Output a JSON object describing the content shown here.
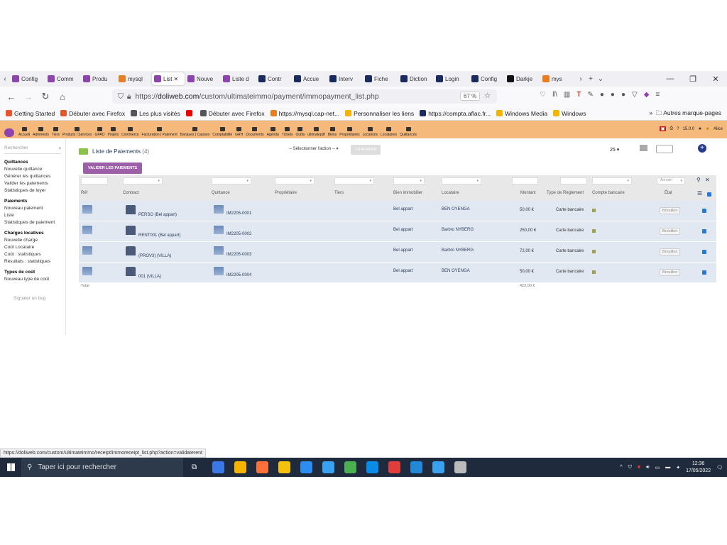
{
  "browser": {
    "tabs": [
      {
        "label": "Config",
        "color": "#8e44ad"
      },
      {
        "label": "Comm",
        "color": "#8e44ad"
      },
      {
        "label": "Produ",
        "color": "#8e44ad"
      },
      {
        "label": "mysql",
        "color": "#e67e22"
      },
      {
        "label": "List",
        "color": "#8e44ad",
        "active": true
      },
      {
        "label": "Nouve",
        "color": "#8e44ad"
      },
      {
        "label": "Liste d",
        "color": "#8e44ad"
      },
      {
        "label": "Contr",
        "color": "#1a2a5c"
      },
      {
        "label": "Accue",
        "color": "#1a2a5c"
      },
      {
        "label": "Interv",
        "color": "#1a2a5c"
      },
      {
        "label": "Fiche",
        "color": "#1a2a5c"
      },
      {
        "label": "Diction",
        "color": "#1a2a5c"
      },
      {
        "label": "Login",
        "color": "#1a2a5c"
      },
      {
        "label": "Config",
        "color": "#1a2a5c"
      },
      {
        "label": "Darkje",
        "color": "#111"
      },
      {
        "label": "mys",
        "color": "#e67e22"
      }
    ],
    "url_prefix": "https://",
    "url_domain": "doliweb.com",
    "url_path": "/custom/ultimateimmo/payment/immopayment_list.php",
    "zoom": "67 %",
    "bookmarks": [
      {
        "label": "Getting Started",
        "color": "#e8542c"
      },
      {
        "label": "Débuter avec Firefox",
        "color": "#e8542c"
      },
      {
        "label": "Les plus visités",
        "color": "#555"
      },
      {
        "label": "",
        "color": "#e00"
      },
      {
        "label": "Débuter avec Firefox",
        "color": "#555"
      },
      {
        "label": "https://mysql.cap-net...",
        "color": "#e67e22"
      },
      {
        "label": "Personnaliser les liens",
        "color": "#f4b400"
      },
      {
        "label": "https://compta.aflac.fr...",
        "color": "#1a2a5c"
      },
      {
        "label": "Windows Media",
        "color": "#f4b400"
      },
      {
        "label": "Windows",
        "color": "#f4b400"
      }
    ],
    "bookmarks_other": "Autres marque-pages",
    "status_url": "https://doliweb.com/custom/ultimateimmo/receipt/immoreceipt_list.php?action=validaterent"
  },
  "menu": {
    "items": [
      "Accueil",
      "Adhérents",
      "Tiers",
      "Produits | Services",
      "GPAO",
      "Projets",
      "Commerce",
      "Facturation | Paiement",
      "Banques | Caisses",
      "Comptabilité",
      "GRH",
      "Documents",
      "Agenda",
      "Tickets",
      "Outils",
      "ultimatepdf",
      "Biens",
      "Propriétaires",
      "Locations",
      "Locataires",
      "Quittances"
    ],
    "version": "15.0.0",
    "user": "Alice"
  },
  "sidebar": {
    "search_placeholder": "Rechercher",
    "groups": [
      {
        "title": "Quittances",
        "items": [
          "Nouvelle quittance",
          "Générer les quittances",
          "Valider les paiements",
          "Statistiques de loyer"
        ]
      },
      {
        "title": "Paiements",
        "items": [
          "Nouveau paiement",
          "Liste",
          "Statistiques de paiement"
        ]
      },
      {
        "title": "Charges locatives",
        "items": [
          "Nouvelle charge",
          "Coût Locataire",
          "Coût : statistiques",
          "Résultats : statistiques"
        ]
      },
      {
        "title": "Types de coût",
        "items": [
          "Nouveau type de coût"
        ]
      }
    ],
    "footer": "Signaler un bug"
  },
  "main": {
    "title": "Liste de Paiements",
    "count": "(4)",
    "select_action": "-- Sélectionner l'action --",
    "confirm": "CONFIRMER",
    "page_size": "25",
    "validate_button": "VALIDER LES PAIEMENTS",
    "filter_cancel": "Annuler",
    "columns": [
      "Réf",
      "Contract",
      "Quittance",
      "Propriétaire",
      "Tiers",
      "Bien immobilier",
      "Locataire",
      "Montant",
      "Type de Règlement",
      "Compte bancaire",
      "État"
    ],
    "rows": [
      {
        "contract": "PERSO (Bel appart)",
        "quittance": "IM2205-0001",
        "bien": "Bel appart",
        "locataire": "BEN OYENGA",
        "montant": "50,00 €",
        "type": "Carte bancaire",
        "etat": "Brouillon"
      },
      {
        "contract": "RENT001 (Bel appart)",
        "quittance": "IM2205-0002",
        "bien": "Bel appart",
        "locataire": "Barbro NYBERG",
        "montant": "250,00 €",
        "type": "Carte bancaire",
        "etat": "Brouillon"
      },
      {
        "contract": "(PROV3) (VILLA)",
        "quittance": "IM2205-0003",
        "bien": "Bel appart",
        "locataire": "Barbro NYBERG",
        "montant": "72,00 €",
        "type": "Carte bancaire",
        "etat": "Brouillon"
      },
      {
        "contract": "001 (VILLA)",
        "quittance": "IM2205-0004",
        "bien": "Bel appart",
        "locataire": "BEN OYENGA",
        "montant": "50,00 €",
        "type": "Carte bancaire",
        "etat": "Brouillon"
      }
    ],
    "total_label": "Total",
    "total_value": "422,00 €"
  },
  "taskbar": {
    "search_placeholder": "Taper ici pour rechercher",
    "time": "12:36",
    "date": "17/05/2022",
    "apps": [
      "#3b78e7",
      "#f4b400",
      "#ff7139",
      "#f4c20d",
      "#2d8cf0",
      "#3aa0f0",
      "#4caf50",
      "#0b8be8",
      "#e23d3d",
      "#2488d8",
      "#3aa0f0",
      "#bbb"
    ]
  }
}
